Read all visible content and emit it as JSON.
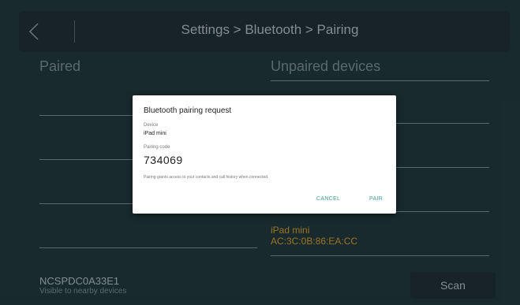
{
  "header": {
    "title": "Settings > Bluetooth > Pairing"
  },
  "paired": {
    "title": "Paired"
  },
  "unpaired": {
    "title": "Unpaired devices",
    "devices": [
      {
        "name": "iPad mini",
        "address": "AC:3C:0B:86:EA:CC"
      }
    ]
  },
  "footer": {
    "host_name": "NCSPDC0A33E1",
    "host_visibility": "Visible to nearby devices",
    "scan_label": "Scan"
  },
  "dialog": {
    "title": "Bluetooth pairing request",
    "device_label": "Device",
    "device_value": "iPad mini",
    "code_label": "Pairing code",
    "code_value": "734069",
    "note": "Pairing grants access to your contacts and call history when connected.",
    "cancel_label": "CANCEL",
    "pair_label": "PAIR"
  },
  "colors": {
    "background": "#1d3236",
    "bar": "#1c2a2d",
    "device_accent": "#b88a2c",
    "dialog_button": "#3e9e98"
  }
}
